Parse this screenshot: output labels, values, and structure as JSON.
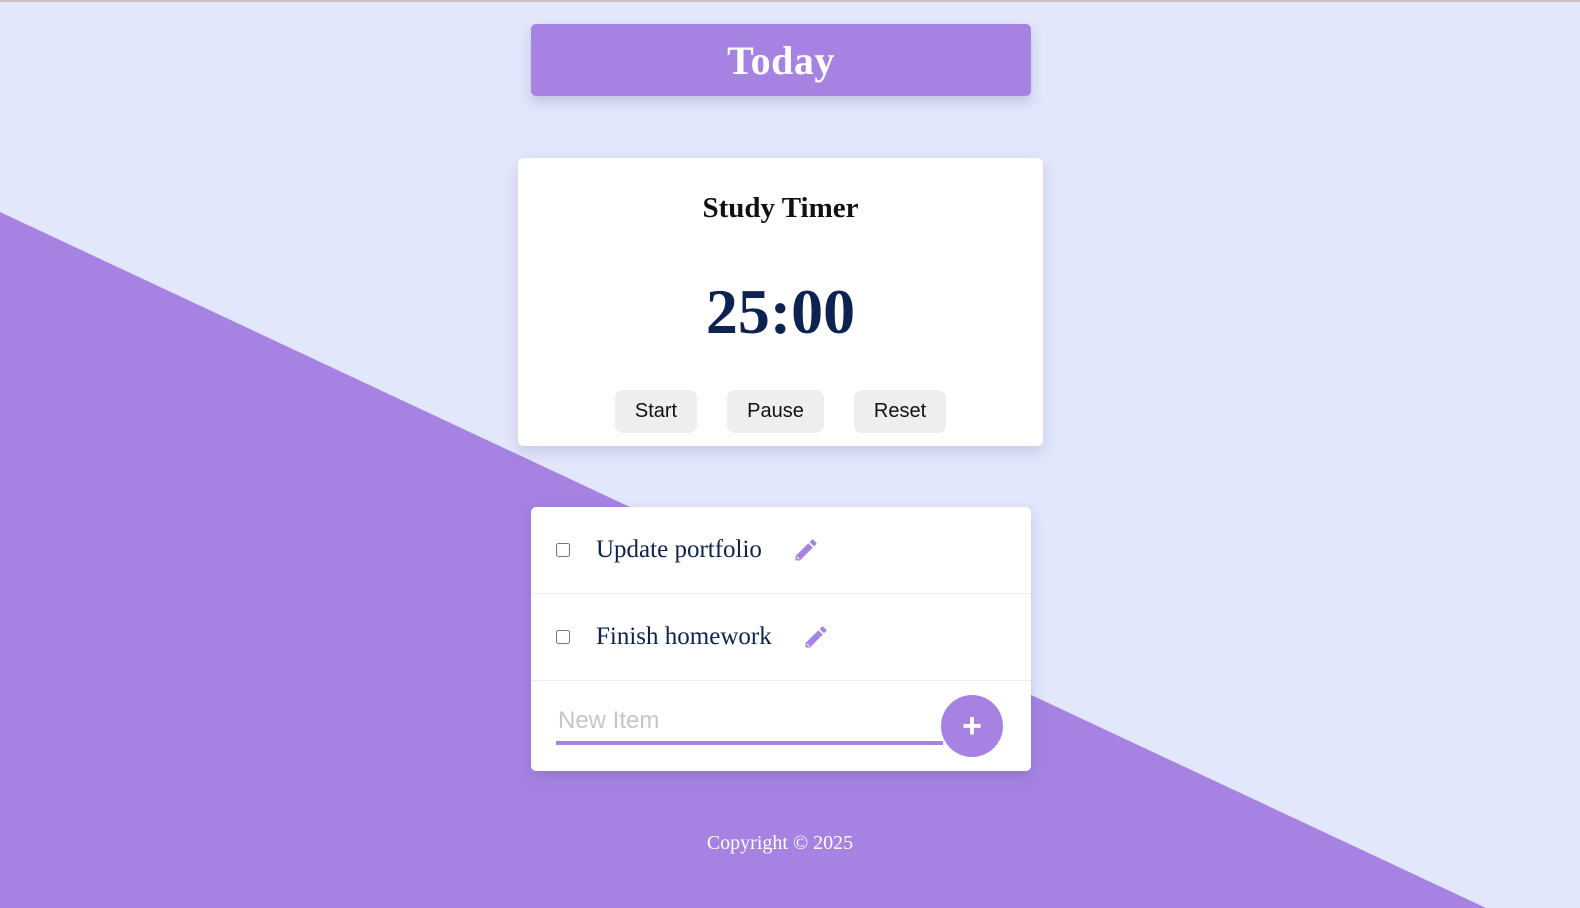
{
  "header": {
    "title": "Today"
  },
  "timer": {
    "title": "Study Timer",
    "display": "25:00",
    "start_label": "Start",
    "pause_label": "Pause",
    "reset_label": "Reset"
  },
  "todo": {
    "items": [
      {
        "label": "Update portfolio",
        "checked": false
      },
      {
        "label": "Finish homework",
        "checked": false
      }
    ],
    "new_item_placeholder": "New Item",
    "add_label": "+"
  },
  "footer": {
    "copyright": "Copyright © 2025"
  },
  "colors": {
    "background": "#E2E7FB",
    "accent": "#A683E3",
    "text_dark": "#0D2250"
  },
  "icons": {
    "edit": "pencil-icon"
  }
}
